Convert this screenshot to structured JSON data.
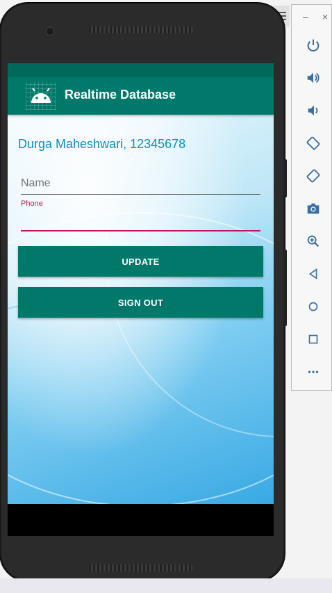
{
  "app": {
    "title": "Realtime Database"
  },
  "main": {
    "user_info": "Durga Maheshwari, 12345678",
    "name_placeholder": "Name",
    "phone_label": "Phone",
    "phone_value": "",
    "update_label": "UPDATE",
    "signout_label": "SIGN OUT"
  },
  "emulator_toolbar": {
    "minimize_label": "–",
    "close_label": "×",
    "buttons": [
      {
        "icon": "power-icon"
      },
      {
        "icon": "volume-up-icon"
      },
      {
        "icon": "volume-down-icon"
      },
      {
        "icon": "rotate-left-icon"
      },
      {
        "icon": "rotate-right-icon"
      },
      {
        "icon": "camera-icon"
      },
      {
        "icon": "zoom-icon"
      },
      {
        "icon": "back-icon"
      },
      {
        "icon": "home-icon"
      },
      {
        "icon": "overview-icon"
      },
      {
        "icon": "more-icon"
      }
    ]
  },
  "colors": {
    "primary": "#00796b",
    "primary_dark": "#00695c",
    "accent": "#c2185b",
    "user_text": "#0a8fc4"
  }
}
